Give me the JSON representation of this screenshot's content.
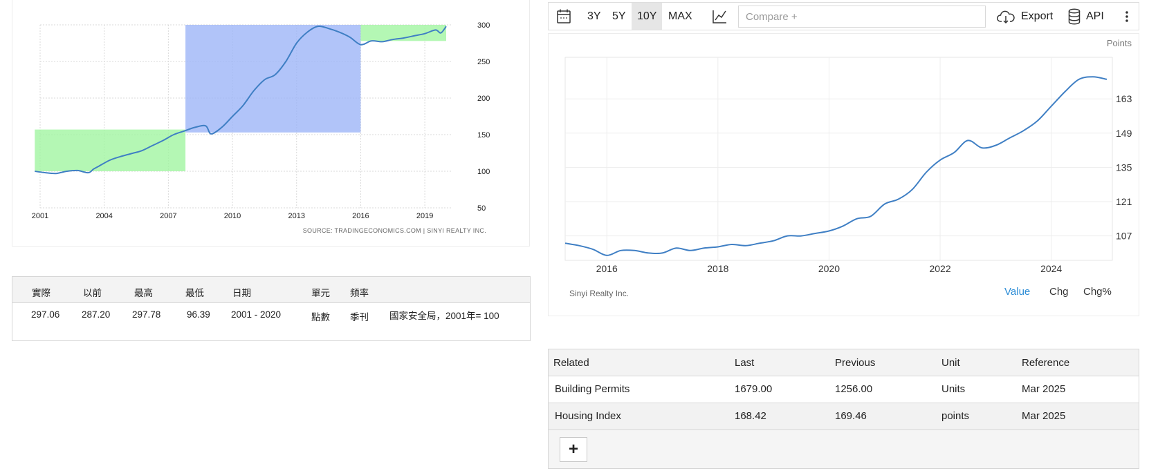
{
  "left_chart": {
    "source": "SOURCE: TRADINGECONOMICS.COM | SINYI REALTY INC.",
    "y_ticks": [
      "300",
      "250",
      "200",
      "150",
      "100",
      "50"
    ],
    "x_ticks": [
      "2001",
      "2004",
      "2007",
      "2010",
      "2013",
      "2016",
      "2019"
    ]
  },
  "stats": {
    "headers": [
      "實際",
      "以前",
      "最高",
      "最低",
      "日期",
      "單元",
      "頻率"
    ],
    "values": [
      "297.06",
      "287.20",
      "297.78",
      "96.39",
      "2001 - 2020",
      "點數",
      "季刊"
    ],
    "description": "國家安全局，2001年= 100"
  },
  "toolbar": {
    "ranges": [
      "3Y",
      "5Y",
      "10Y",
      "MAX"
    ],
    "selected_range": "10Y",
    "compare_placeholder": "Compare +",
    "export_label": "Export",
    "api_label": "API",
    "icons": [
      "calendar-icon",
      "line-chart-icon",
      "cloud-download-icon",
      "database-icon",
      "more-vertical-icon"
    ]
  },
  "right_chart": {
    "unit_label": "Points",
    "source": "Sinyi Realty Inc.",
    "y_ticks": [
      "163",
      "149",
      "135",
      "121",
      "107"
    ],
    "x_ticks": [
      "2016",
      "2018",
      "2020",
      "2022",
      "2024"
    ],
    "tabs": [
      "Value",
      "Chg",
      "Chg%"
    ],
    "selected_tab": "Value"
  },
  "related": {
    "headers": [
      "Related",
      "Last",
      "Previous",
      "Unit",
      "Reference"
    ],
    "rows": [
      [
        "Building Permits",
        "1679.00",
        "1256.00",
        "Units",
        "Mar 2025"
      ],
      [
        "Housing Index",
        "168.42",
        "169.46",
        "points",
        "Mar 2025"
      ]
    ],
    "add_label": "+"
  },
  "colors": {
    "line": "#3f7fc4",
    "green_band": "#9ff59f",
    "blue_band": "#9bb3f7",
    "accent": "#2b8cd6"
  },
  "chart_data": [
    {
      "type": "line",
      "title": "",
      "xlabel": "",
      "ylabel": "",
      "xlim": [
        2001,
        2020
      ],
      "ylim": [
        50,
        300
      ],
      "y_axis_side": "right",
      "grid": true,
      "x": [
        2000.75,
        2001.25,
        2001.75,
        2002.25,
        2002.75,
        2003.25,
        2003.5,
        2003.75,
        2004.25,
        2004.75,
        2005.25,
        2005.75,
        2006.25,
        2006.75,
        2007.25,
        2007.75,
        2008.25,
        2008.75,
        2009.0,
        2009.5,
        2010.0,
        2010.5,
        2011.0,
        2011.5,
        2012.0,
        2012.5,
        2013.0,
        2013.5,
        2014.0,
        2014.5,
        2015.0,
        2015.5,
        2016.0,
        2016.5,
        2017.0,
        2017.5,
        2018.0,
        2018.5,
        2019.0,
        2019.5,
        2019.75,
        2020.0
      ],
      "values": [
        100,
        98,
        97,
        100,
        101,
        98,
        103,
        107,
        115,
        120,
        124,
        128,
        135,
        142,
        150,
        155,
        160,
        162,
        151,
        160,
        175,
        190,
        210,
        225,
        232,
        250,
        275,
        290,
        298,
        295,
        290,
        283,
        273,
        278,
        277,
        280,
        282,
        285,
        288,
        293,
        289,
        298
      ],
      "highlight_regions": [
        {
          "x": [
            2000.75,
            2007.8
          ],
          "y": [
            100,
            157
          ],
          "color": "green"
        },
        {
          "x": [
            2007.8,
            2016.0
          ],
          "y": [
            153,
            300
          ],
          "color": "blue"
        },
        {
          "x": [
            2016.0,
            2020.0
          ],
          "y": [
            278,
            300
          ],
          "color": "green"
        }
      ]
    },
    {
      "type": "line",
      "title": "",
      "xlabel": "",
      "ylabel": "Points",
      "xlim": [
        2015.25,
        2025.1
      ],
      "ylim": [
        97,
        180
      ],
      "y_axis_side": "right",
      "grid": true,
      "x": [
        2015.25,
        2015.5,
        2015.75,
        2016.0,
        2016.25,
        2016.5,
        2016.75,
        2017.0,
        2017.25,
        2017.5,
        2017.75,
        2018.0,
        2018.25,
        2018.5,
        2018.75,
        2019.0,
        2019.25,
        2019.5,
        2019.75,
        2020.0,
        2020.25,
        2020.5,
        2020.75,
        2021.0,
        2021.25,
        2021.5,
        2021.75,
        2022.0,
        2022.25,
        2022.5,
        2022.75,
        2023.0,
        2023.25,
        2023.5,
        2023.75,
        2024.0,
        2024.25,
        2024.5,
        2024.75,
        2025.0
      ],
      "values": [
        104,
        103,
        101.5,
        99,
        101,
        101,
        100,
        100,
        102,
        101,
        102,
        102.5,
        103.5,
        103,
        104,
        105,
        107,
        107,
        108,
        109,
        111,
        114,
        115,
        120,
        122,
        126,
        133,
        138,
        141,
        146,
        143,
        144,
        147,
        150,
        154,
        160,
        166,
        171,
        172,
        171
      ]
    }
  ]
}
